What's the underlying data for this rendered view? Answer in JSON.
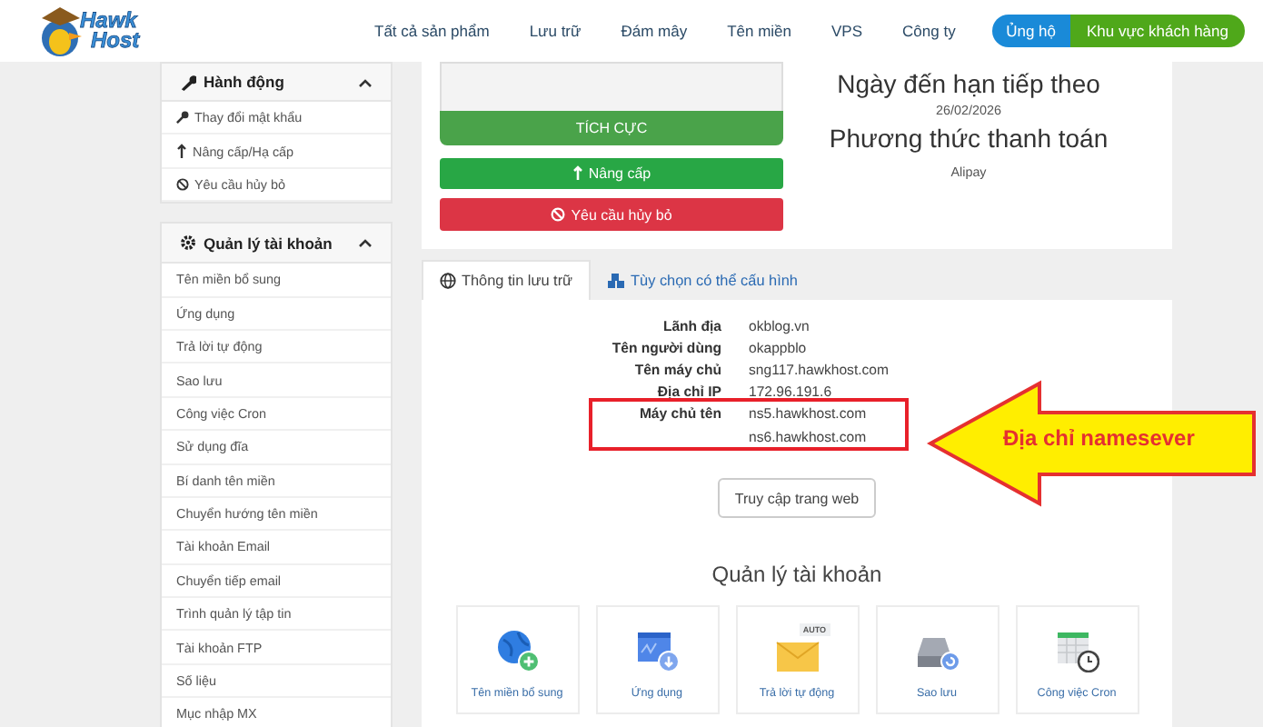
{
  "logo": {
    "line_1": "Hawk",
    "line_2": "Host"
  },
  "nav": {
    "items": [
      "Tất cả sản phẩm",
      "Lưu trữ",
      "Đám mây",
      "Tên miền",
      "VPS",
      "Công ty"
    ],
    "support_button": "Ủng hộ",
    "client_area_button": "Khu vực khách hàng"
  },
  "sidebar": {
    "panels": [
      {
        "title": "Hành động",
        "expanded": true,
        "items": [
          "Thay đổi mật khẩu",
          "Nâng cấp/Hạ cấp",
          "Yêu cầu hủy bỏ"
        ]
      },
      {
        "title": "Quản lý tài khoản",
        "expanded": true,
        "items": [
          "Tên miền bổ sung",
          "Ứng dụng",
          "Trả lời tự động",
          "Sao lưu",
          "Công việc Cron",
          "Sử dụng đĩa",
          "Bí danh tên miền",
          "Chuyển hướng tên miền",
          "Tài khoản Email",
          "Chuyển tiếp email",
          "Trình quản lý tập tin",
          "Tài khoản FTP",
          "Số liệu",
          "Mục nhập MX"
        ]
      }
    ]
  },
  "overview": {
    "status": "TÍCH CỰC",
    "upgrade_button": "Nâng cấp",
    "cancel_button": "Yêu cầu hủy bỏ",
    "due_label": "Ngày đến hạn tiếp theo",
    "due_date": "26/02/2026",
    "payment_label": "Phương thức thanh toán",
    "payment_method": "Alipay"
  },
  "tabs": [
    {
      "label": "Thông tin lưu trữ",
      "selected": true
    },
    {
      "label": "Tùy chọn có thể cấu hình",
      "selected": false
    }
  ],
  "info": [
    {
      "label": "Lãnh địa",
      "values": [
        "okblog.vn"
      ],
      "highlighted": false
    },
    {
      "label": "Tên người dùng",
      "values": [
        "okappblo"
      ],
      "highlighted": false
    },
    {
      "label": "Tên máy chủ",
      "values": [
        "sng117.hawkhost.com"
      ],
      "highlighted": false
    },
    {
      "label": "Địa chỉ IP",
      "values": [
        "172.96.191.6"
      ],
      "highlighted": false
    },
    {
      "label": "Máy chủ tên",
      "values": [
        "ns5.hawkhost.com",
        "ns6.hawkhost.com"
      ],
      "highlighted": true
    }
  ],
  "visit_button": "Truy cập trang web",
  "account_section": {
    "title": "Quản lý tài khoản",
    "tiles": [
      "Tên miền bổ sung",
      "Ứng dụng",
      "Trả lời tự động",
      "Sao lưu",
      "Công việc Cron"
    ],
    "auto_badge": "AUTO"
  },
  "annotation": {
    "label": "Địa chỉ namesever"
  }
}
